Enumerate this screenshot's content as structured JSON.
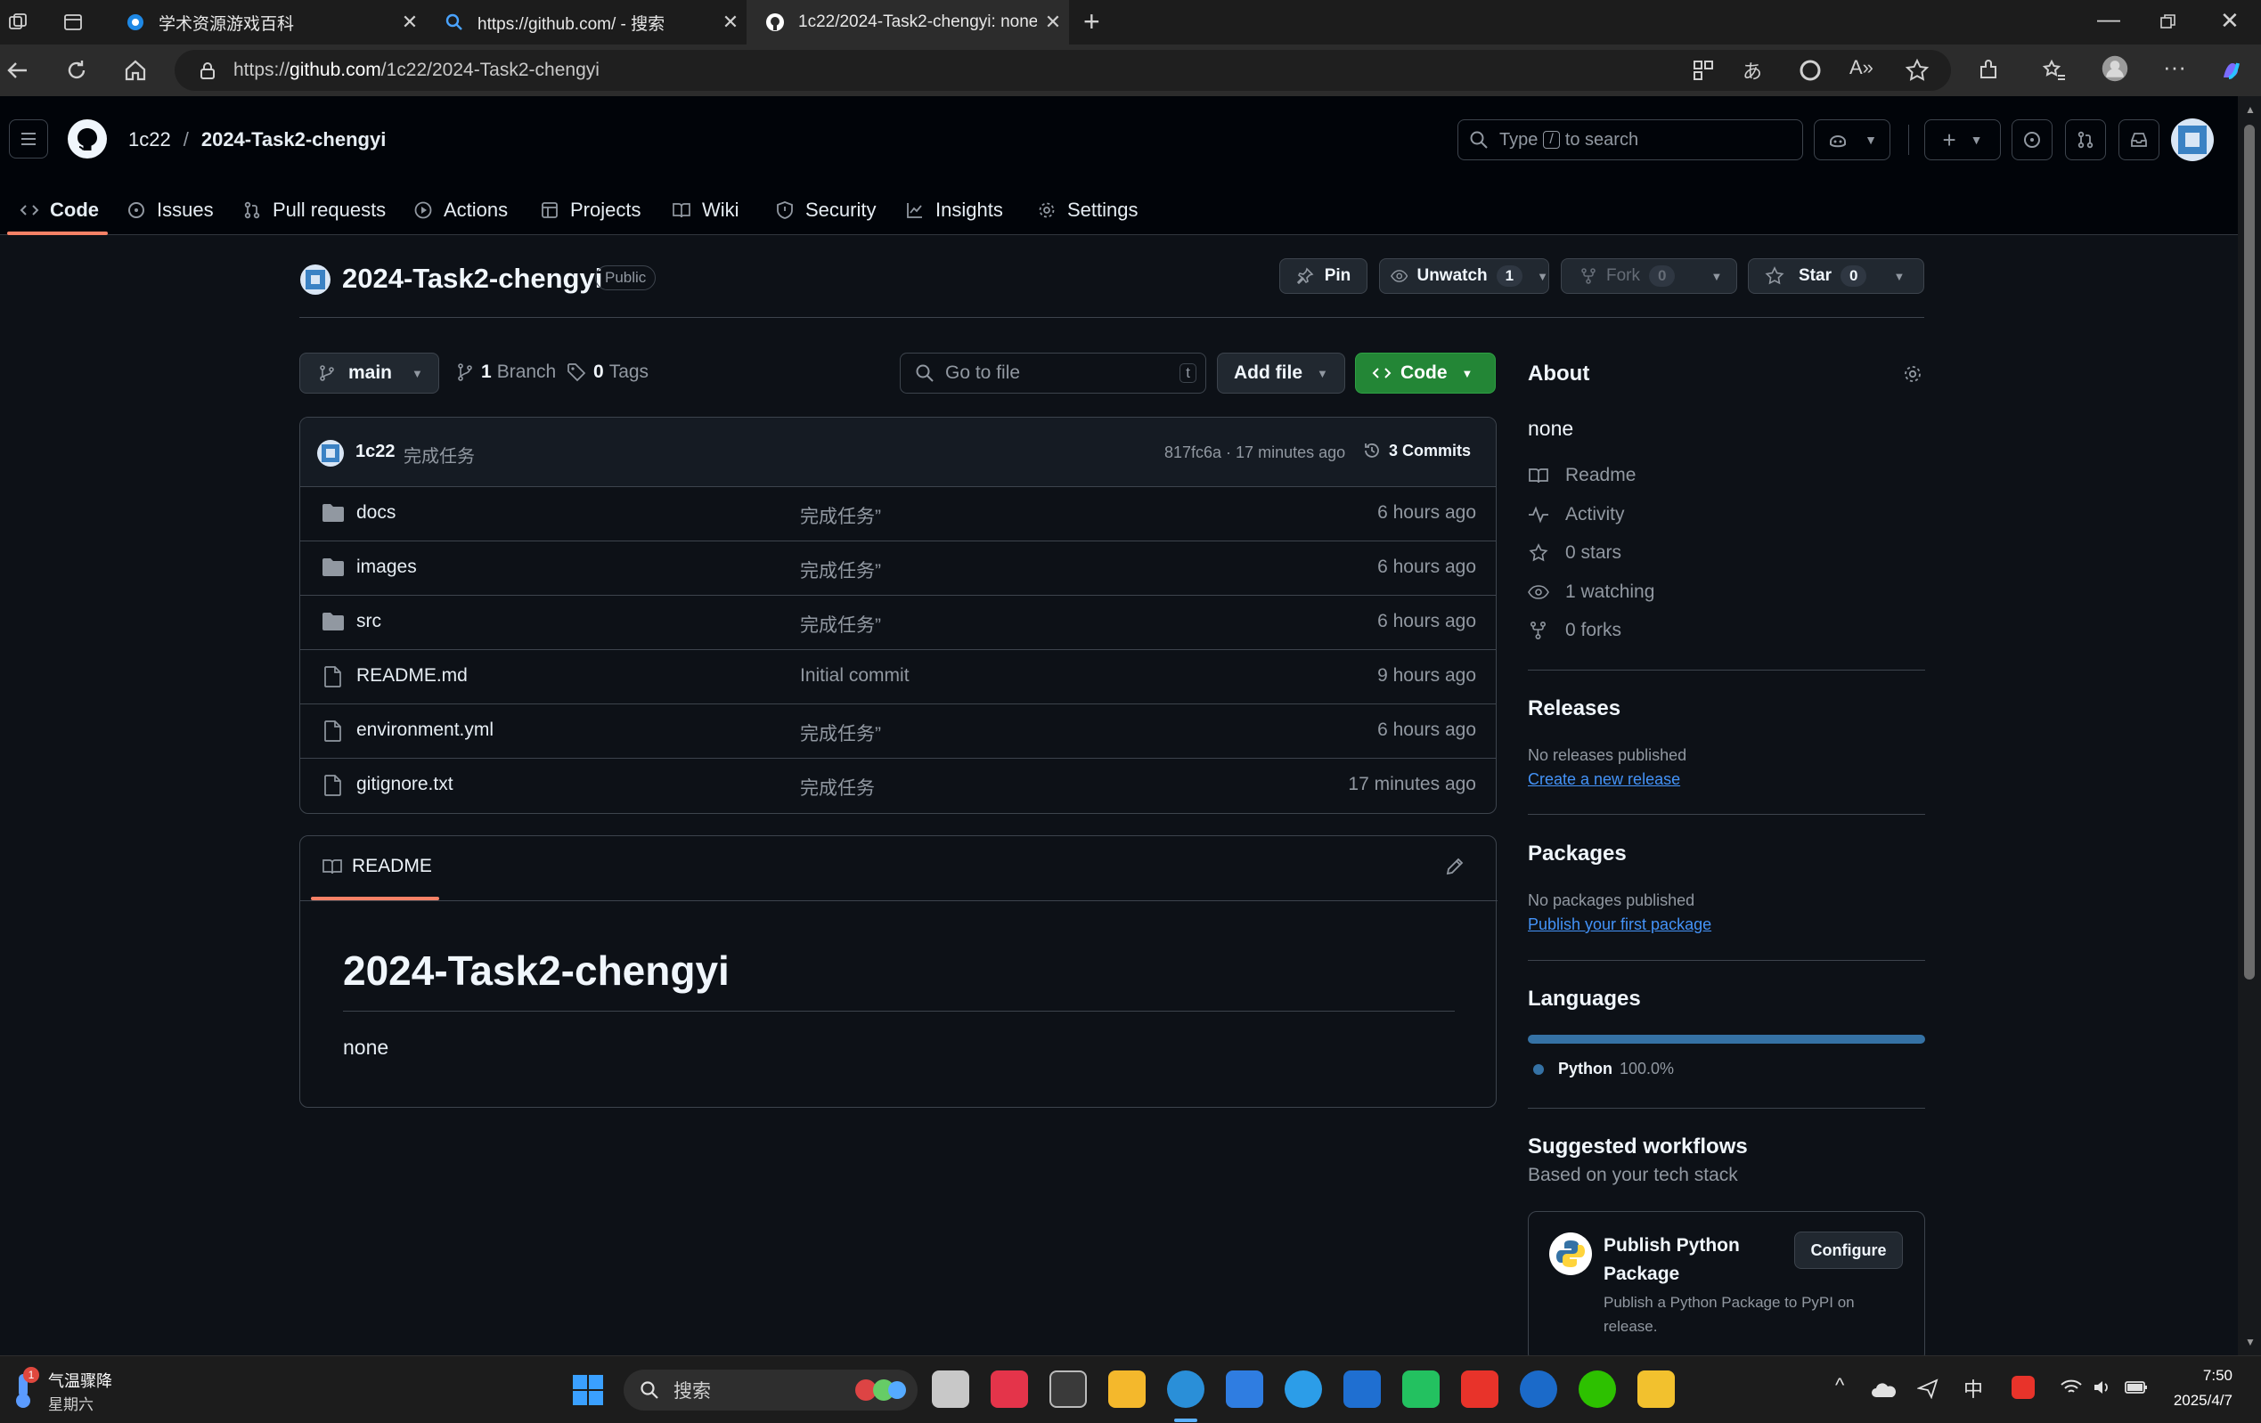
{
  "browser": {
    "tabs": [
      {
        "label": "学术资源游戏百科",
        "icon": "edge-collection-icon"
      },
      {
        "label": "https://github.com/ - 搜索",
        "icon": "search-icon"
      },
      {
        "label": "1c22/2024-Task2-chengyi: none",
        "icon": "github-icon",
        "active": true
      }
    ],
    "url_prefix": "https://",
    "url_host": "github.com",
    "url_path": "/1c22/2024-Task2-chengyi"
  },
  "header": {
    "owner": "1c22",
    "separator": "/",
    "repo": "2024-Task2-chengyi",
    "search_prefix": "Type",
    "search_key": "/",
    "search_suffix": "to search"
  },
  "nav": {
    "code": "Code",
    "issues": "Issues",
    "pulls": "Pull requests",
    "actions": "Actions",
    "projects": "Projects",
    "wiki": "Wiki",
    "security": "Security",
    "insights": "Insights",
    "settings": "Settings"
  },
  "repo": {
    "name": "2024-Task2-chengyi",
    "visibility": "Public",
    "pin": "Pin",
    "unwatch": "Unwatch",
    "watch_count": "1",
    "fork": "Fork",
    "fork_count": "0",
    "star": "Star",
    "star_count": "0"
  },
  "toolbar": {
    "branch": "main",
    "branch_count": "1",
    "branch_label": "Branch",
    "tag_count": "0",
    "tag_label": "Tags",
    "goto_placeholder": "Go to file",
    "goto_key": "t",
    "add_file": "Add file",
    "code": "Code"
  },
  "commit": {
    "author": "1c22",
    "message": "完成任务",
    "sha_time": "817fc6a · 17 minutes ago",
    "commits": "3 Commits"
  },
  "files": [
    {
      "name": "docs",
      "type": "folder",
      "message": "完成任务”",
      "date": "6 hours ago"
    },
    {
      "name": "images",
      "type": "folder",
      "message": "完成任务”",
      "date": "6 hours ago"
    },
    {
      "name": "src",
      "type": "folder",
      "message": "完成任务”",
      "date": "6 hours ago"
    },
    {
      "name": "README.md",
      "type": "file",
      "message": "Initial commit",
      "date": "9 hours ago"
    },
    {
      "name": "environment.yml",
      "type": "file",
      "message": "完成任务”",
      "date": "6 hours ago"
    },
    {
      "name": "gitignore.txt",
      "type": "file",
      "message": "完成任务",
      "date": "17 minutes ago"
    }
  ],
  "readme": {
    "tab": "README",
    "heading": "2024-Task2-chengyi",
    "body": "none"
  },
  "about": {
    "title": "About",
    "description": "none",
    "readme": "Readme",
    "activity": "Activity",
    "stars": "0 stars",
    "watching": "1 watching",
    "forks": "0 forks"
  },
  "releases": {
    "title": "Releases",
    "none": "No releases published",
    "create": "Create a new release"
  },
  "packages": {
    "title": "Packages",
    "none": "No packages published",
    "publish": "Publish your first package"
  },
  "languages": {
    "title": "Languages",
    "items": [
      {
        "name": "Python",
        "percent": "100.0%",
        "color": "#3572A5",
        "share": 1.0
      }
    ]
  },
  "workflows": {
    "title": "Suggested workflows",
    "subtitle": "Based on your tech stack",
    "card_title": "Publish Python Package",
    "card_desc": "Publish a Python Package to PyPI on release.",
    "configure": "Configure"
  },
  "taskbar": {
    "weather_title": "气温骤降",
    "weather_sub": "星期六",
    "weather_badge": "1",
    "search": "搜索",
    "ime": "中",
    "time": "7:50",
    "date": "2025/4/7"
  },
  "colors": {
    "accent_green": "#238636",
    "link_blue": "#4493f8",
    "tab_underline": "#f78166"
  }
}
